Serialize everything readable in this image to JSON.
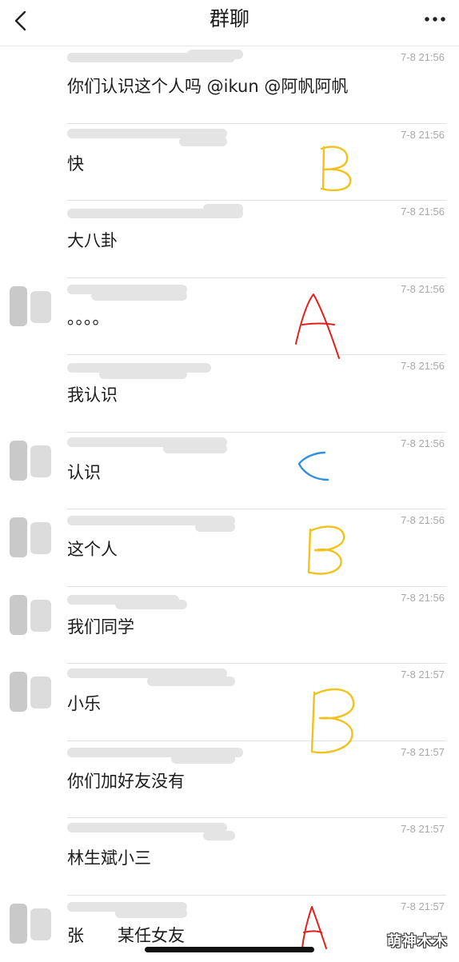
{
  "navbar": {
    "title": "群聊",
    "back_icon": "chevron-left-icon",
    "more_icon": "more-dots-icon"
  },
  "messages": [
    {
      "time": "7-8 21:56",
      "text": "你们认识这个人吗 @ikun @阿帆阿帆",
      "has_avatar": false
    },
    {
      "time": "7-8 21:56",
      "text": "快",
      "has_avatar": false
    },
    {
      "time": "7-8 21:56",
      "text": "大八卦",
      "has_avatar": false
    },
    {
      "time": "7-8 21:56",
      "text": "。。。。",
      "has_avatar": true
    },
    {
      "time": "7-8 21:56",
      "text": "我认识",
      "has_avatar": false
    },
    {
      "time": "7-8 21:56",
      "text": "认识",
      "has_avatar": true
    },
    {
      "time": "7-8 21:56",
      "text": "这个人",
      "has_avatar": true
    },
    {
      "time": "7-8 21:56",
      "text": "我们同学",
      "has_avatar": true
    },
    {
      "time": "7-8 21:57",
      "text": "小乐",
      "has_avatar": true
    },
    {
      "time": "7-8 21:57",
      "text": "你们加好友没有",
      "has_avatar": false
    },
    {
      "time": "7-8 21:57",
      "text": "林生斌小三",
      "has_avatar": false
    },
    {
      "time": "7-8 21:57",
      "text": "张　　某任女友",
      "has_avatar": true
    }
  ],
  "annotations": [
    {
      "letter": "B",
      "color": "#f2c21b"
    },
    {
      "letter": "A",
      "color": "#e0201c"
    },
    {
      "letter": "C",
      "color": "#2f8fe0"
    },
    {
      "letter": "B",
      "color": "#f2c21b"
    },
    {
      "letter": "B",
      "color": "#f2c21b"
    },
    {
      "letter": "A",
      "color": "#e0201c"
    }
  ],
  "watermark": "萌神木木",
  "colors": {
    "timestamp": "#a8a8a8",
    "text": "#1c1c1c",
    "separator": "#e3e3e3"
  }
}
